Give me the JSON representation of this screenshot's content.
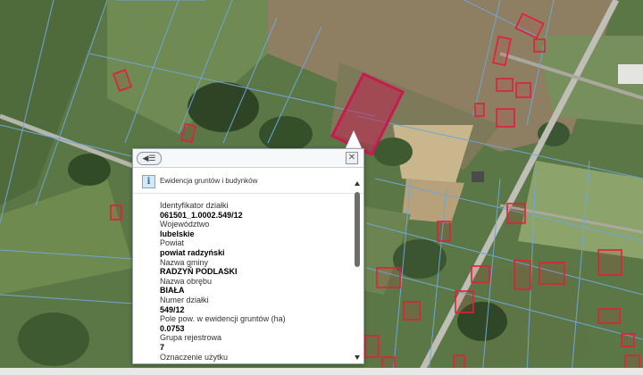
{
  "map": {
    "selected_parcel_color": "#c81a4f",
    "building_outline_color": "#e0203a",
    "parcel_line_color": "#6fa6d6"
  },
  "popup": {
    "collapse_icon": "list-collapse-icon",
    "close_icon": "close-icon",
    "layer_icon": "info-icon",
    "layer_icon_glyph": "i",
    "layer_title": "Ewidencja gruntów i budynków",
    "attributes": [
      {
        "label": "Identyfikator działki",
        "value": "061501_1.0002.549/12"
      },
      {
        "label": "Województwo",
        "value": "lubelskie"
      },
      {
        "label": "Powiat",
        "value": "powiat radzyński"
      },
      {
        "label": "Nazwa gminy",
        "value": "RADZYŃ PODLASKI"
      },
      {
        "label": "Nazwa obrębu",
        "value": "BIAŁA"
      },
      {
        "label": "Numer działki",
        "value": "549/12"
      },
      {
        "label": "Pole pow. w ewidencji gruntów (ha)",
        "value": "0.0753"
      },
      {
        "label": "Grupa rejestrowa",
        "value": "7"
      },
      {
        "label": "Oznaczenie użytku",
        "value": ""
      }
    ]
  }
}
